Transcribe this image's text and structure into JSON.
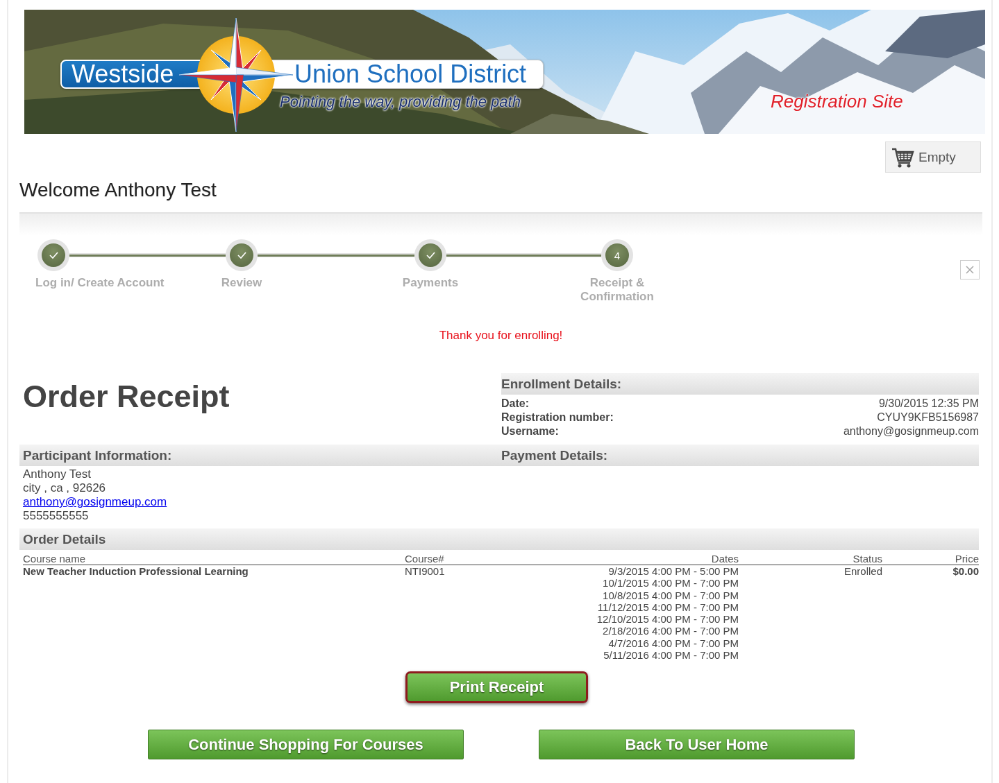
{
  "banner": {
    "kind": "picture",
    "logo_left": "Westside",
    "logo_right": "Union School District",
    "tagline": "Pointing the way, providing the path",
    "site_label": "Registration Site"
  },
  "cart": {
    "label": "Empty"
  },
  "welcome": "Welcome Anthony Test",
  "steps": [
    {
      "label": "Log in/ Create Account",
      "completed": true
    },
    {
      "label": "Review",
      "completed": true
    },
    {
      "label": "Payments",
      "completed": true
    },
    {
      "label": "Receipt & Confirmation",
      "completed": false,
      "marker": "4"
    }
  ],
  "message": "Thank you for enrolling!",
  "title": "Order Receipt",
  "enrollment": {
    "heading": "Enrollment Details:",
    "rows": [
      {
        "label": "Date:",
        "value": "9/30/2015 12:35 PM"
      },
      {
        "label": "Registration number:",
        "value": "CYUY9KFB5156987"
      },
      {
        "label": "Username:",
        "value": "anthony@gosignmeup.com"
      }
    ]
  },
  "participant": {
    "heading": "Participant Information:",
    "name": "Anthony Test",
    "address": "city , ca , 92626",
    "email": "anthony@gosignmeup.com",
    "phone": "5555555555"
  },
  "payment": {
    "heading": "Payment Details:"
  },
  "order": {
    "heading": "Order Details",
    "columns": [
      "Course name",
      "Course#",
      "Dates",
      "Status",
      "Price"
    ],
    "rows": [
      {
        "course_name": "New Teacher Induction Professional Learning",
        "course_number": "NTI9001",
        "dates": [
          "9/3/2015 4:00 PM - 5:00 PM",
          "10/1/2015 4:00 PM - 7:00 PM",
          "10/8/2015 4:00 PM - 7:00 PM",
          "11/12/2015 4:00 PM - 7:00 PM",
          "12/10/2015 4:00 PM - 7:00 PM",
          "2/18/2016 4:00 PM - 7:00 PM",
          "4/7/2016 4:00 PM - 7:00 PM",
          "5/11/2016 4:00 PM - 7:00 PM"
        ],
        "status": "Enrolled",
        "price": "$0.00"
      }
    ]
  },
  "buttons": [
    {
      "label": "Print Receipt",
      "kind": "print"
    },
    {
      "label": "Continue Shopping For Courses",
      "kind": "nav"
    },
    {
      "label": "Back To User Home",
      "kind": "nav"
    }
  ]
}
